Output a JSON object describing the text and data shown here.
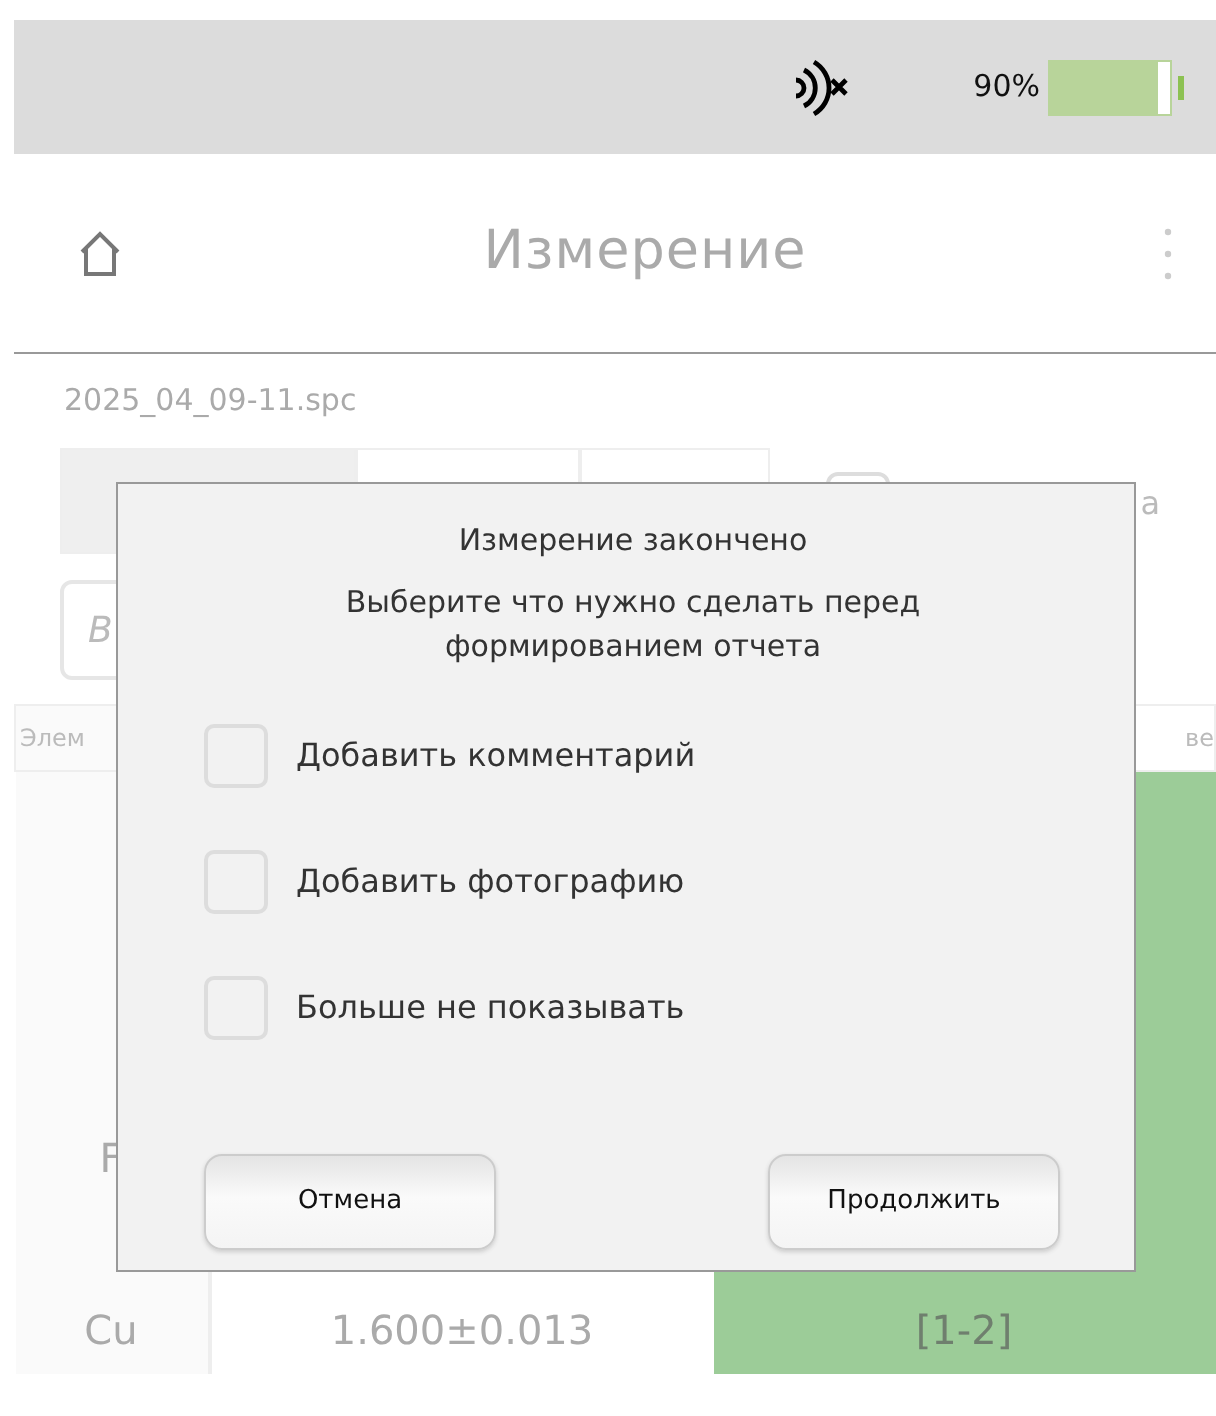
{
  "status_bar": {
    "battery_text": "90%",
    "battery": {
      "level": 0.9
    }
  },
  "header": {
    "title": "Измерение"
  },
  "file_name": "2025_04_09-11.spc",
  "tabs": [
    {
      "selected": true
    },
    {
      "selected": false
    },
    {
      "selected": false
    }
  ],
  "option": {
    "label": "а",
    "checked": false
  },
  "search": {
    "placeholder": "В"
  },
  "table": {
    "column_1": "Элем",
    "column_3": "ве",
    "rows": [
      {
        "element": "F"
      },
      {
        "element": "Cu",
        "value": "1.600±0.013",
        "range": "[1-2]"
      }
    ]
  },
  "dialog": {
    "title": "Измерение закончено",
    "message": "Выберите что нужно сделать перед формированием отчета",
    "options": [
      {
        "label": "Добавить комментарий",
        "checked": false
      },
      {
        "label": "Добавить фотографию",
        "checked": false
      },
      {
        "label": "Больше не показывать",
        "checked": false
      }
    ],
    "buttons": [
      "Отмена",
      "Продолжить"
    ]
  }
}
